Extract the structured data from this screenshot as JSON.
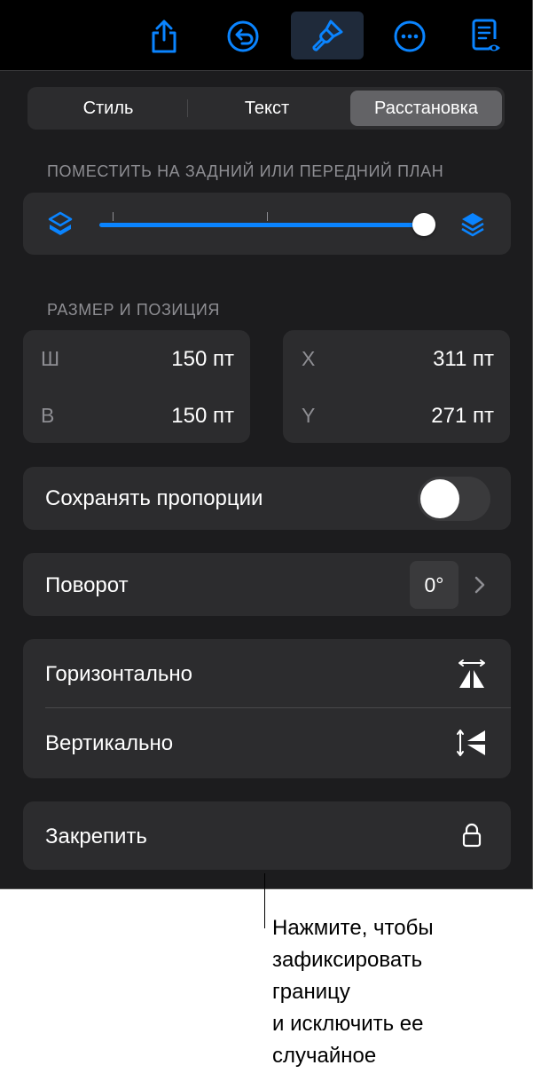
{
  "toolbar": {
    "buttons": [
      {
        "icon": "share-icon"
      },
      {
        "icon": "undo-icon"
      },
      {
        "icon": "format-brush-icon",
        "active": true
      },
      {
        "icon": "more-icon"
      },
      {
        "icon": "reading-view-icon"
      }
    ],
    "accent_color": "#0a84ff"
  },
  "tabs": [
    {
      "label": "Стиль",
      "selected": false
    },
    {
      "label": "Текст",
      "selected": false
    },
    {
      "label": "Расстановка",
      "selected": true
    }
  ],
  "layering": {
    "section_label": "ПОМЕСТИТЬ НА ЗАДНИЙ ИЛИ ПЕРЕДНИЙ ПЛАН",
    "slider_value_fraction": 1.0,
    "back_icon": "layers-back-icon",
    "front_icon": "layers-front-icon"
  },
  "size_position": {
    "section_label": "РАЗМЕР И ПОЗИЦИЯ",
    "width_label": "Ш",
    "width_value": "150 пт",
    "height_label": "В",
    "height_value": "150 пт",
    "x_label": "X",
    "x_value": "311 пт",
    "y_label": "Y",
    "y_value": "271 пт"
  },
  "constrain": {
    "label": "Сохранять пропорции",
    "on": false
  },
  "rotate": {
    "label": "Поворот",
    "value": "0°"
  },
  "flip": {
    "horizontal_label": "Горизонтально",
    "vertical_label": "Вертикально"
  },
  "lock": {
    "label": "Закрепить",
    "icon": "lock-icon"
  },
  "callout": {
    "text": "Нажмите, чтобы\nзафиксировать\nграницу\nи исключить ее\nслучайное"
  }
}
